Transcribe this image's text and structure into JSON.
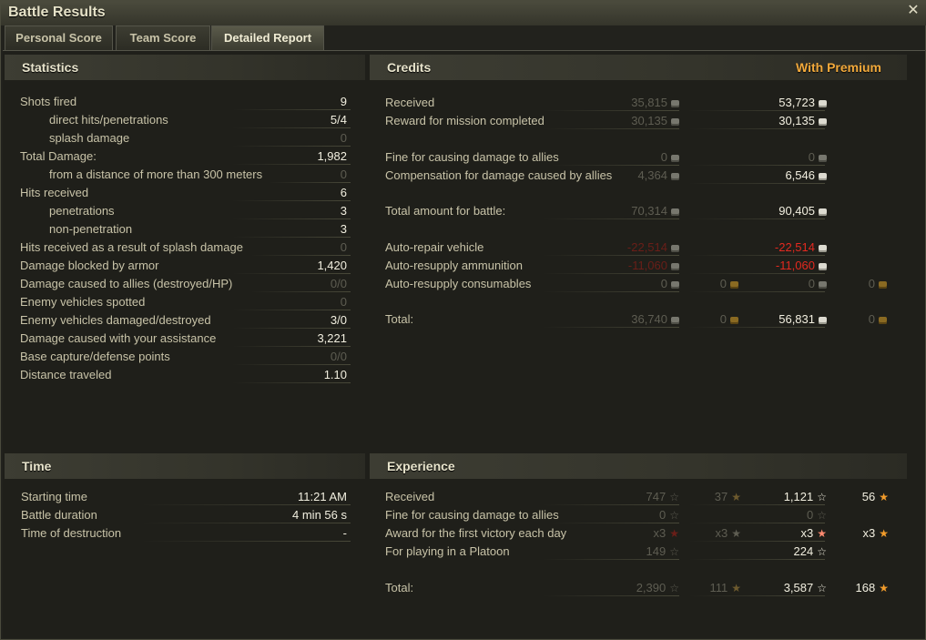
{
  "window": {
    "title": "Battle Results"
  },
  "tabs": [
    {
      "label": "Personal Score"
    },
    {
      "label": "Team Score"
    },
    {
      "label": "Detailed Report"
    }
  ],
  "statistics": {
    "title": "Statistics",
    "rows": [
      {
        "label": "Shots fired",
        "value": "9"
      },
      {
        "label": "direct hits/penetrations",
        "value": "5/4"
      },
      {
        "label": "splash damage",
        "value": "0"
      },
      {
        "label": "Total Damage:",
        "value": "1,982"
      },
      {
        "label": "from a distance of more than 300 meters",
        "value": "0"
      },
      {
        "label": "Hits received",
        "value": "6"
      },
      {
        "label": "penetrations",
        "value": "3"
      },
      {
        "label": "non-penetration",
        "value": "3"
      },
      {
        "label": "Hits received as a result of splash damage",
        "value": "0"
      },
      {
        "label": "Damage blocked by armor",
        "value": "1,420"
      },
      {
        "label": "Damage caused to allies (destroyed/HP)",
        "value": "0/0"
      },
      {
        "label": "Enemy vehicles spotted",
        "value": "0"
      },
      {
        "label": "Enemy vehicles damaged/destroyed",
        "value": "3/0"
      },
      {
        "label": "Damage caused with your assistance",
        "value": "3,221"
      },
      {
        "label": "Base capture/defense points",
        "value": "0/0"
      },
      {
        "label": "Distance traveled",
        "value": "1.10"
      }
    ]
  },
  "credits": {
    "title": "Credits",
    "premium_label": "With Premium",
    "rows": [
      {
        "label": "Received",
        "base": "35,815",
        "premium": "53,723"
      },
      {
        "label": "Reward for mission completed",
        "base": "30,135",
        "premium": "30,135"
      },
      {
        "label": "Fine for causing damage to allies",
        "base": "0",
        "premium": "0"
      },
      {
        "label": "Compensation for damage caused by allies",
        "base": "4,364",
        "premium": "6,546"
      },
      {
        "label": "Total amount for battle:",
        "base": "70,314",
        "premium": "90,405"
      },
      {
        "label": "Auto-repair vehicle",
        "base": "-22,514",
        "premium": "-22,514"
      },
      {
        "label": "Auto-resupply ammunition",
        "base": "-11,060",
        "premium": "-11,060"
      },
      {
        "label": "Auto-resupply consumables",
        "base": "0",
        "base_gold": "0",
        "premium": "0",
        "premium_gold": "0"
      },
      {
        "label": "Total:",
        "base": "36,740",
        "base_gold": "0",
        "premium": "56,831",
        "premium_gold": "0"
      }
    ]
  },
  "time": {
    "title": "Time",
    "rows": [
      {
        "label": "Starting time",
        "value": "11:21 AM"
      },
      {
        "label": "Battle duration",
        "value": "4 min 56 s"
      },
      {
        "label": "Time of destruction",
        "value": "-"
      }
    ]
  },
  "experience": {
    "title": "Experience",
    "rows": [
      {
        "label": "Received",
        "base": "747",
        "base_free": "37",
        "premium": "1,121",
        "premium_free": "56"
      },
      {
        "label": "Fine for causing damage to allies",
        "base": "0",
        "premium": "0"
      },
      {
        "label": "Award for the first victory each day",
        "base": "x3",
        "base_free": "x3",
        "premium": "x3",
        "premium_free": "x3"
      },
      {
        "label": "For playing in a Platoon",
        "base": "149",
        "premium": "224"
      },
      {
        "label": "Total:",
        "base": "2,390",
        "base_free": "111",
        "premium": "3,587",
        "premium_free": "168"
      }
    ]
  }
}
